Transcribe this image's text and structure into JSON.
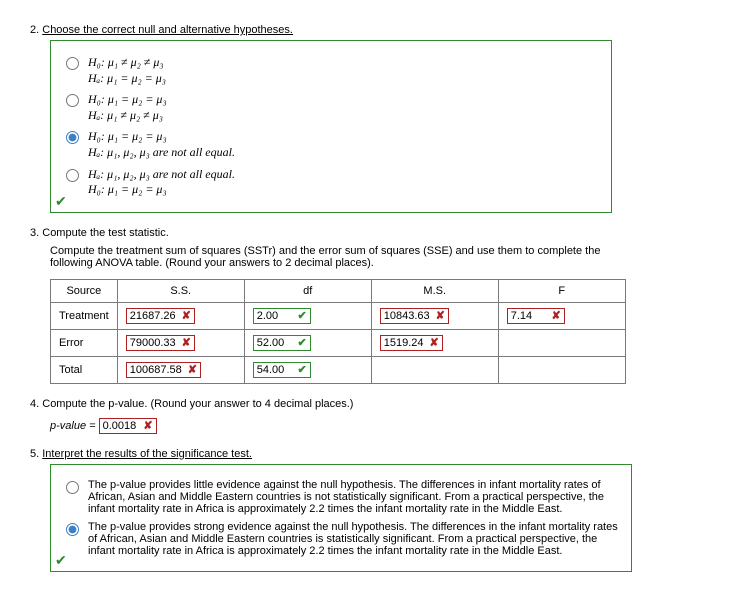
{
  "q2": {
    "number": "2.",
    "prompt": "Choose the correct null and alternative hypotheses.",
    "options": [
      {
        "h0": "H₀: μ₁ ≠ μ₂ ≠ μ₃",
        "ha": "Hₐ: μ₁ = μ₂ = μ₃",
        "selected": false
      },
      {
        "h0": "H₀: μ₁ = μ₂ = μ₃",
        "ha": "Hₐ: μ₁ ≠ μ₂ ≠ μ₃",
        "selected": false
      },
      {
        "h0": "H₀: μ₁ = μ₂ = μ₃",
        "ha": "Hₐ: μ₁, μ₂, μ₃ are not all equal.",
        "selected": true
      },
      {
        "h0": "Hₐ: μ₁, μ₂, μ₃ are not all equal.",
        "ha": "H₀: μ₁ = μ₂ = μ₃",
        "selected": false
      }
    ]
  },
  "q3": {
    "number": "3.",
    "prompt": "Compute the test statistic.",
    "detail": "Compute the treatment sum of squares (SSTr) and the error sum of squares (SSE) and use them to complete the following ANOVA table. (Round your answers to 2 decimal places).",
    "headers": {
      "source": "Source",
      "ss": "S.S.",
      "df": "df",
      "ms": "M.S.",
      "f": "F"
    },
    "rows": {
      "treatment": {
        "label": "Treatment",
        "ss": {
          "v": "21687.26",
          "ok": false
        },
        "df": {
          "v": "2.00",
          "ok": true
        },
        "ms": {
          "v": "10843.63",
          "ok": false
        },
        "f": {
          "v": "7.14",
          "ok": false
        }
      },
      "error": {
        "label": "Error",
        "ss": {
          "v": "79000.33",
          "ok": false
        },
        "df": {
          "v": "52.00",
          "ok": true
        },
        "ms": {
          "v": "1519.24",
          "ok": false
        }
      },
      "total": {
        "label": "Total",
        "ss": {
          "v": "100687.58",
          "ok": false
        },
        "df": {
          "v": "54.00",
          "ok": true
        }
      }
    }
  },
  "q4": {
    "number": "4.",
    "prompt": "Compute the p-value. (Round your answer to 4 decimal places.)",
    "label": "p-value =",
    "value": {
      "v": "0.0018",
      "ok": false
    }
  },
  "q5": {
    "number": "5.",
    "prompt": "Interpret the results of the significance test.",
    "options": [
      {
        "text": "The p-value provides little evidence against the null hypothesis. The differences in infant mortality rates of African, Asian and Middle Eastern countries is not statistically significant. From a practical perspective, the infant mortality rate in Africa is approximately 2.2 times the infant mortality rate in the Middle East.",
        "selected": false
      },
      {
        "text": "The p-value provides strong evidence against the null hypothesis. The differences in the infant mortality rates of African, Asian and Middle Eastern countries is statistically significant. From a practical perspective, the infant mortality rate in Africa is approximately 2.2 times the infant mortality rate in the Middle East.",
        "selected": true
      }
    ]
  }
}
